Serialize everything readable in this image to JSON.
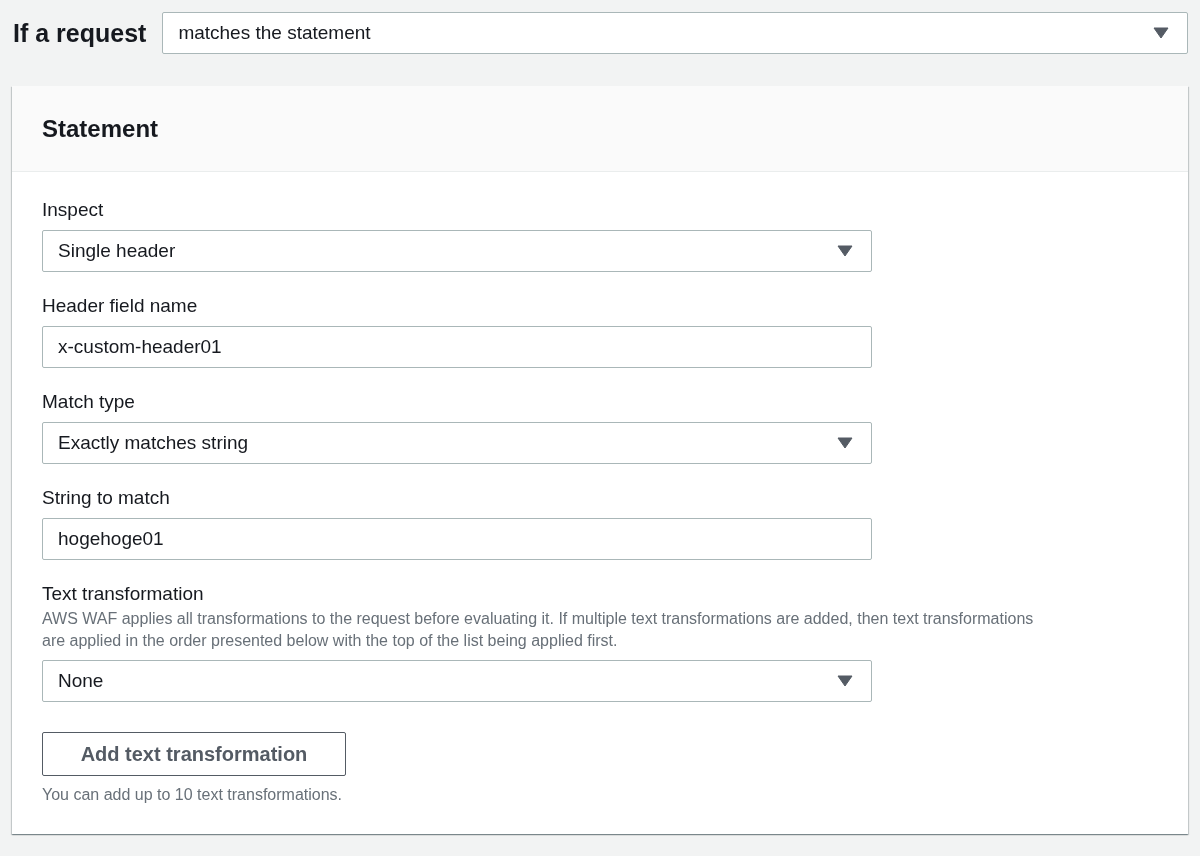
{
  "condition": {
    "label": "If a request",
    "value": "matches the statement"
  },
  "panel": {
    "title": "Statement",
    "fields": [
      {
        "kind": "select",
        "label": "Inspect",
        "value": "Single header"
      },
      {
        "kind": "input",
        "label": "Header field name",
        "value": "x-custom-header01"
      },
      {
        "kind": "select",
        "label": "Match type",
        "value": "Exactly matches string"
      },
      {
        "kind": "input",
        "label": "String to match",
        "value": "hogehoge01"
      },
      {
        "kind": "select",
        "label": "Text transformation",
        "description": "AWS WAF applies all transformations to the request before evaluating it. If multiple text transformations are added, then text transformations are applied in the order presented below with the top of the list being applied first.",
        "value": "None"
      }
    ],
    "button": "Add text transformation",
    "hint": "You can add up to 10 text transformations."
  }
}
